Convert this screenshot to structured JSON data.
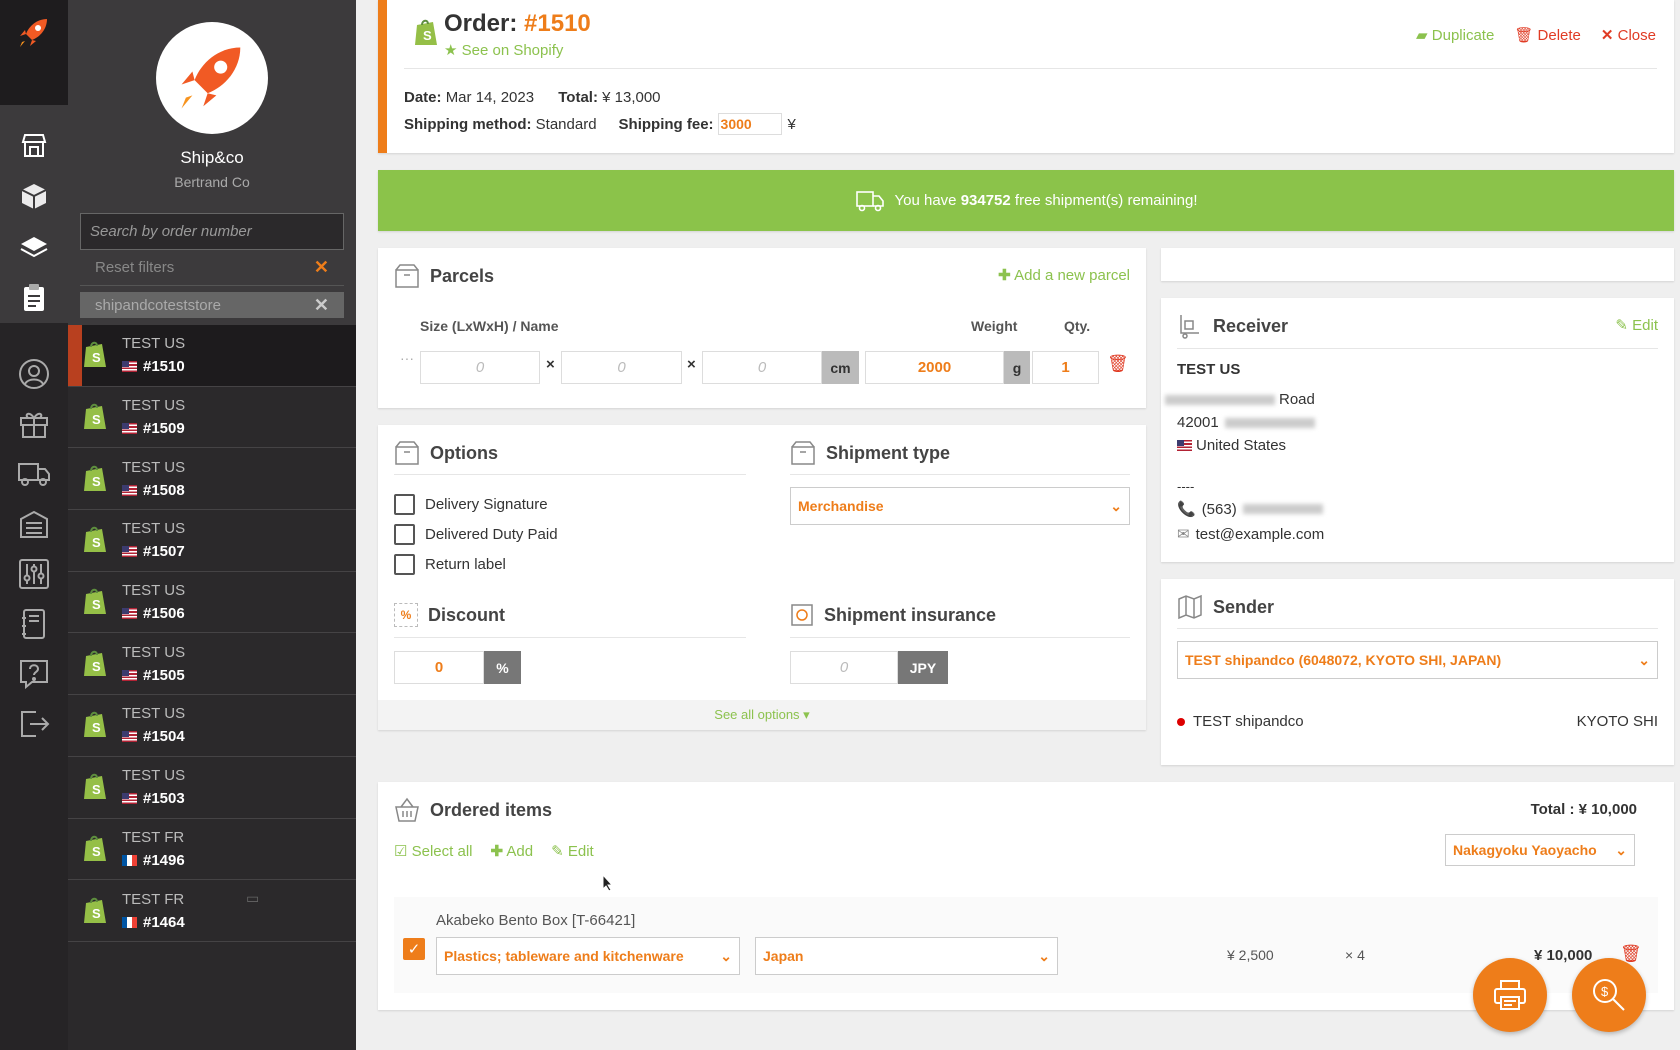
{
  "sidebar": {
    "company_name": "Ship&co",
    "company_sub": "Bertrand Co",
    "search_placeholder": "Search by order number",
    "reset_filters": "Reset filters",
    "filter_chip": "shipandcoteststore",
    "orders": [
      {
        "name": "TEST US",
        "number": "#1510",
        "country": "US",
        "active": true
      },
      {
        "name": "TEST US",
        "number": "#1509",
        "country": "US"
      },
      {
        "name": "TEST US",
        "number": "#1508",
        "country": "US"
      },
      {
        "name": "TEST US",
        "number": "#1507",
        "country": "US"
      },
      {
        "name": "TEST US",
        "number": "#1506",
        "country": "US"
      },
      {
        "name": "TEST US",
        "number": "#1505",
        "country": "US"
      },
      {
        "name": "TEST US",
        "number": "#1504",
        "country": "US"
      },
      {
        "name": "TEST US",
        "number": "#1503",
        "country": "US"
      },
      {
        "name": "TEST FR",
        "number": "#1496",
        "country": "FR"
      },
      {
        "name": "TEST FR",
        "number": "#1464",
        "country": "FR",
        "has_comment": true
      }
    ]
  },
  "order": {
    "title_prefix": "Order:",
    "number": "#1510",
    "see_on": "See on Shopify",
    "duplicate": "Duplicate",
    "delete": "Delete",
    "close": "Close",
    "date_label": "Date:",
    "date": "Mar 14, 2023",
    "total_label": "Total:",
    "total": "¥ 13,000",
    "shipping_method_label": "Shipping method:",
    "shipping_method": "Standard",
    "shipping_fee_label": "Shipping fee:",
    "shipping_fee": "3000",
    "currency_symbol": "¥"
  },
  "banner": {
    "pre": "You have",
    "count": "934752",
    "post": "free shipment(s) remaining!"
  },
  "parcels": {
    "title": "Parcels",
    "add": "Add a new parcel",
    "size_header": "Size (LxWxH) / Name",
    "weight_header": "Weight",
    "qty_header": "Qty.",
    "dims_placeholder": "0",
    "times": "×",
    "dims_unit": "cm",
    "weight": "2000",
    "weight_unit": "g",
    "qty": "1",
    "ellipsis": "···"
  },
  "options": {
    "title": "Options",
    "items": [
      "Delivery Signature",
      "Delivered Duty Paid",
      "Return label"
    ],
    "shipment_type_title": "Shipment type",
    "shipment_type": "Merchandise",
    "discount_title": "Discount",
    "discount_value": "0",
    "discount_unit": "%",
    "insurance_title": "Shipment insurance",
    "insurance_placeholder": "0",
    "insurance_unit": "JPY",
    "see_all": "See all options ▾"
  },
  "receiver": {
    "title": "Receiver",
    "edit": "Edit",
    "name": "TEST US",
    "street": "Road",
    "zip": "42001",
    "country": "United States",
    "dashes": "----",
    "phone": "(563)",
    "email": "test@example.com"
  },
  "sender": {
    "title": "Sender",
    "select": "TEST shipandco (6048072, KYOTO SHI, JAPAN)",
    "name": "TEST shipandco",
    "city": "KYOTO SHI"
  },
  "items": {
    "title": "Ordered items",
    "total": "Total : ¥ 10,000",
    "select_all": "Select all",
    "add": "Add",
    "edit": "Edit",
    "warehouse": "Nakagyoku Yaoyacho",
    "rows": [
      {
        "name": "Akabeko Bento Box [T-66421]",
        "category": "Plastics; tableware and kitchenware",
        "origin": "Japan",
        "price": "¥ 2,500",
        "qty": "× 4",
        "total": "¥ 10,000"
      }
    ]
  },
  "colors": {
    "accent": "#ee7d1a",
    "green": "#8bc34a",
    "danger": "#e03b24",
    "dark": "#2b292b"
  }
}
